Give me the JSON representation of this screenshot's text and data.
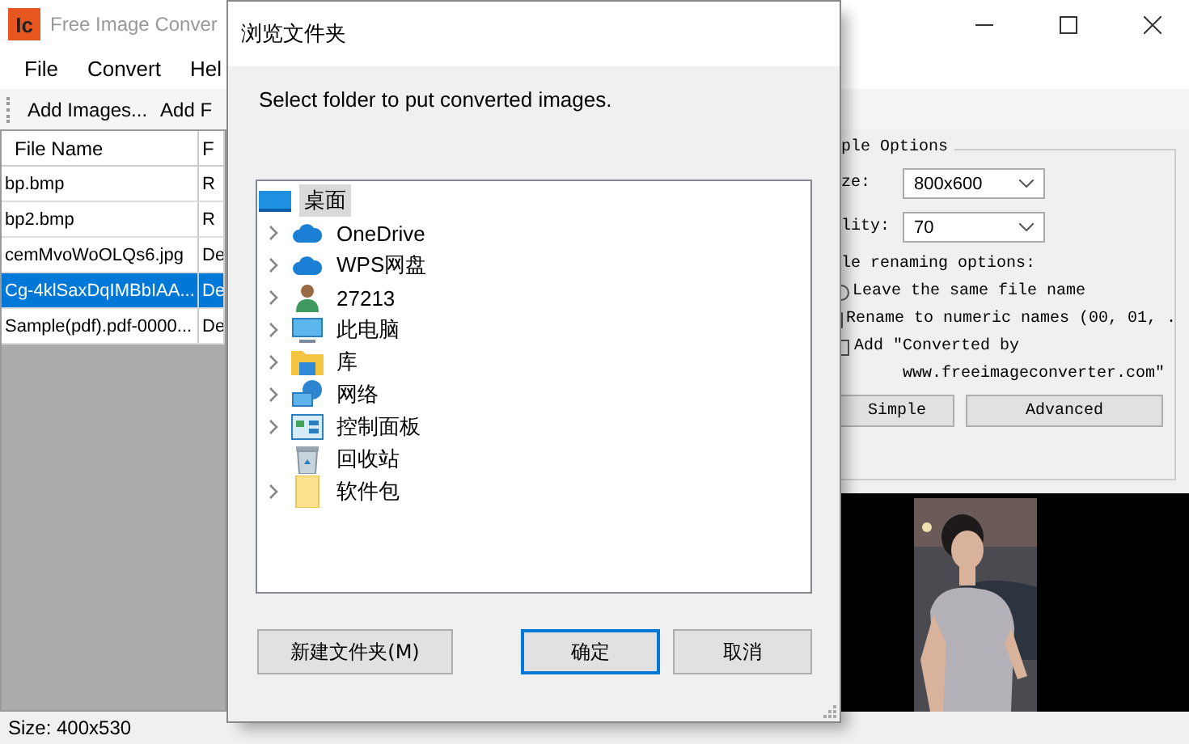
{
  "window": {
    "logo": "Ic",
    "title": "Free Image Conver"
  },
  "menu": [
    "File",
    "Convert",
    "Hel"
  ],
  "toolbar": [
    "Add Images...",
    "Add F"
  ],
  "table": {
    "columns": [
      "File Name",
      "F"
    ],
    "rows": [
      {
        "cells": [
          "bp.bmp",
          "R"
        ],
        "selected": false
      },
      {
        "cells": [
          "bp2.bmp",
          "R"
        ],
        "selected": false
      },
      {
        "cells": [
          "cemMvoWoOLQs6.jpg",
          "De"
        ],
        "selected": false
      },
      {
        "cells": [
          "Cg-4klSaxDqIMBbIAA...",
          "De"
        ],
        "selected": true
      },
      {
        "cells": [
          "Sample(pdf).pdf-0000...",
          "De"
        ],
        "selected": false
      }
    ]
  },
  "options": {
    "title": "ple Options",
    "size": {
      "label": "ze:",
      "value": "800x600"
    },
    "quality": {
      "label": "lity:",
      "value": "70"
    },
    "renaming_label": "le renaming options:",
    "radios": [
      {
        "label": "Leave the same file name",
        "selected": false
      },
      {
        "label": "Rename to numeric names (00, 01, .",
        "selected": false
      }
    ],
    "checkbox": {
      "label": "Add \"Converted by",
      "label_line2": "www.freeimageconverter.com\"",
      "checked": false
    },
    "buttons": [
      "Simple",
      "Advanced"
    ]
  },
  "preview": {
    "kind": "picture"
  },
  "status_bar": "Size: 400x530",
  "dialog": {
    "title": "浏览文件夹",
    "prompt": "Select folder to put converted images.",
    "tree": [
      {
        "label": "桌面",
        "kind": "desktop",
        "selected": true,
        "expandable": false,
        "children": [
          {
            "label": "OneDrive",
            "kind": "cloud",
            "selected": false,
            "expandable": true
          },
          {
            "label": "WPS网盘",
            "kind": "cloud",
            "selected": false,
            "expandable": true
          },
          {
            "label": "27213",
            "kind": "user",
            "selected": false,
            "expandable": true
          },
          {
            "label": "此电脑",
            "kind": "computer",
            "selected": false,
            "expandable": true
          },
          {
            "label": "库",
            "kind": "library",
            "selected": false,
            "expandable": true
          },
          {
            "label": "网络",
            "kind": "network",
            "selected": false,
            "expandable": true
          },
          {
            "label": "控制面板",
            "kind": "control-panel",
            "selected": false,
            "expandable": true
          },
          {
            "label": "回收站",
            "kind": "recycle-bin",
            "selected": false,
            "expandable": false
          },
          {
            "label": "软件包",
            "kind": "folder",
            "selected": false,
            "expandable": true
          }
        ]
      }
    ],
    "buttons": [
      {
        "label": "新建文件夹(M)",
        "default": false
      },
      {
        "label": "确定",
        "default": true
      },
      {
        "label": "取消",
        "default": false
      }
    ]
  }
}
